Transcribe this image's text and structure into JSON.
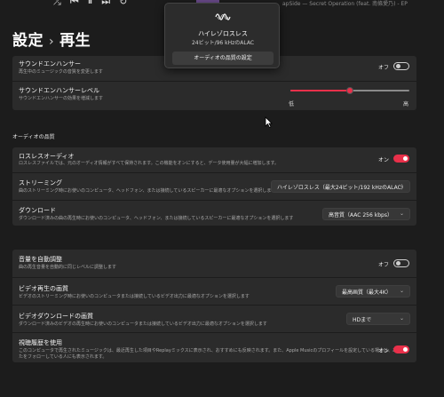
{
  "transport": {
    "shuffle": "⤮",
    "prev": "⏮",
    "pause": "⏸",
    "next": "⏭",
    "repeat": "↻"
  },
  "now_playing": {
    "text": "apSide — Secret Operation (feat. 南條愛乃) - EP"
  },
  "breadcrumb": {
    "root": "設定",
    "separator": "›",
    "current": "再生"
  },
  "popup": {
    "title": "ハイレゾロスレス",
    "subtitle": "24ビット/96 kHzのALAC",
    "button": "オーディオの品質の設定"
  },
  "settings": {
    "sound_enhancer": {
      "title": "サウンドエンハンサー",
      "desc": "再生中のミュージックの音質を変更します",
      "state_label": "オフ",
      "enabled": false
    },
    "sound_enhancer_level": {
      "title": "サウンドエンハンサーレベル",
      "desc": "サウンドエンハンサーの効果を増減します",
      "low_label": "低",
      "high_label": "高",
      "level": 0.5
    },
    "audio_quality_header": "オーディオの品質",
    "lossless": {
      "title": "ロスレスオーディオ",
      "desc": "ロスレスファイルでは、元のオーディオ情報がすべて保持されます。この機能をオンにすると、データ使用量が大幅に増加します。",
      "state_label": "オン",
      "enabled": true
    },
    "streaming": {
      "title": "ストリーミング",
      "desc": "曲のストリーミング時にお使いのコンピュータ、ヘッドフォン、または接続しているスピーカーに最適なオプションを選択します",
      "value": "ハイレゾロスレス（最大24ビット/192 kHzのALAC）"
    },
    "download": {
      "title": "ダウンロード",
      "desc": "ダウンロード済みの曲の再生時にお使いのコンピュータ、ヘッドフォン、または接続しているスピーカーに最適なオプションを選択します",
      "value": "高音質（AAC 256 kbps）"
    },
    "auto_volume": {
      "title": "音量を自動調整",
      "desc": "曲の再生音量を自動的に同じレベルに調整します",
      "state_label": "オフ",
      "enabled": false
    },
    "video_playback": {
      "title": "ビデオ再生の画質",
      "desc": "ビデオのストリーミング時にお使いのコンピュータまたは接続しているビデオ出力に最適なオプションを選択します",
      "value": "最高画質（最大4K）"
    },
    "video_download": {
      "title": "ビデオダウンロードの画質",
      "desc": "ダウンロード済みのビデオの再生時にお使いのコンピュータまたは接続しているビデオ出力に最適なオプションを選択します",
      "value": "HDまで"
    },
    "history": {
      "title": "視聴履歴を使用",
      "desc1": "このコンピュータで再生されたミュージックは、最近再生した項目やReplayミックスに表示され、おすすめにも反映されます。また、Apple Musicのプロフィールを設定している場合は、あな",
      "desc2": "たをフォローしている人にも表示されます。",
      "state_label": "オン",
      "enabled": true
    }
  },
  "colors": {
    "accent": "#e8304a",
    "background": "#1c1c1c",
    "card": "#2b2b2b"
  },
  "icons": {
    "chevron": "⌄",
    "cursor": "arrow-cursor",
    "waveform": "waveform-icon"
  }
}
